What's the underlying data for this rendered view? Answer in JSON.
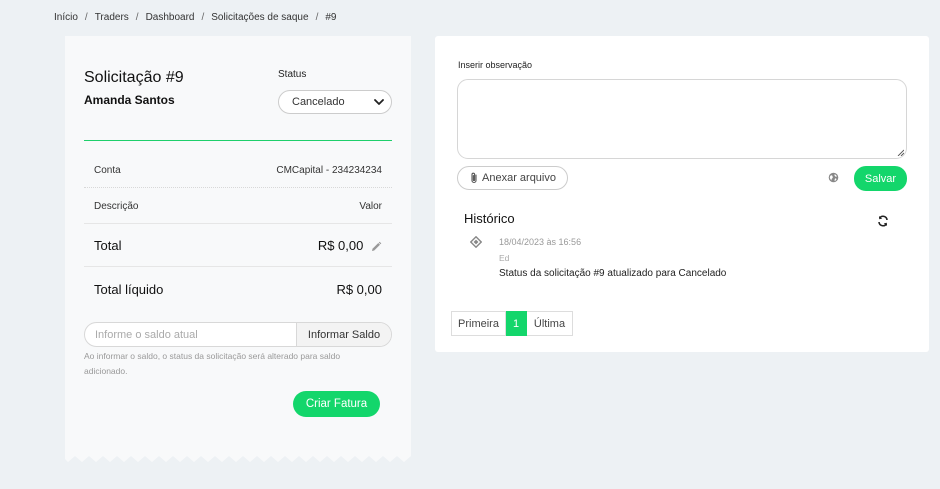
{
  "breadcrumb": [
    "Início",
    "Traders",
    "Dashboard",
    "Solicitações de saque",
    "#9"
  ],
  "request": {
    "title": "Solicitação #9",
    "client_name": "Amanda Santos",
    "status_label": "Status",
    "status_value": "Cancelado"
  },
  "details": {
    "conta_label": "Conta",
    "conta_value": "CMCapital - 234234234",
    "descricao_label": "Descrição",
    "valor_label": "Valor",
    "total_label": "Total",
    "total_value": "R$ 0,00",
    "liquido_label": "Total líquido",
    "liquido_value": "R$ 0,00"
  },
  "saldo": {
    "placeholder": "Informe o saldo atual",
    "button_label": "Informar Saldo",
    "hint": "Ao informar o saldo, o status da solicitação será alterado para saldo adicionado."
  },
  "criar_fatura_label": "Criar Fatura",
  "observation": {
    "label": "Inserir observação",
    "attach_label": "Anexar arquivo",
    "save_label": "Salvar"
  },
  "history": {
    "title": "Histórico",
    "entries": [
      {
        "date": "18/04/2023 às 16:56",
        "user": "Ed",
        "message": "Status da solicitação #9 atualizado para Cancelado"
      }
    ]
  },
  "pagination": {
    "first_label": "Primeira",
    "current_page": "1",
    "last_label": "Última"
  },
  "colors": {
    "accent": "#13d66b",
    "background": "#edf1f4"
  }
}
